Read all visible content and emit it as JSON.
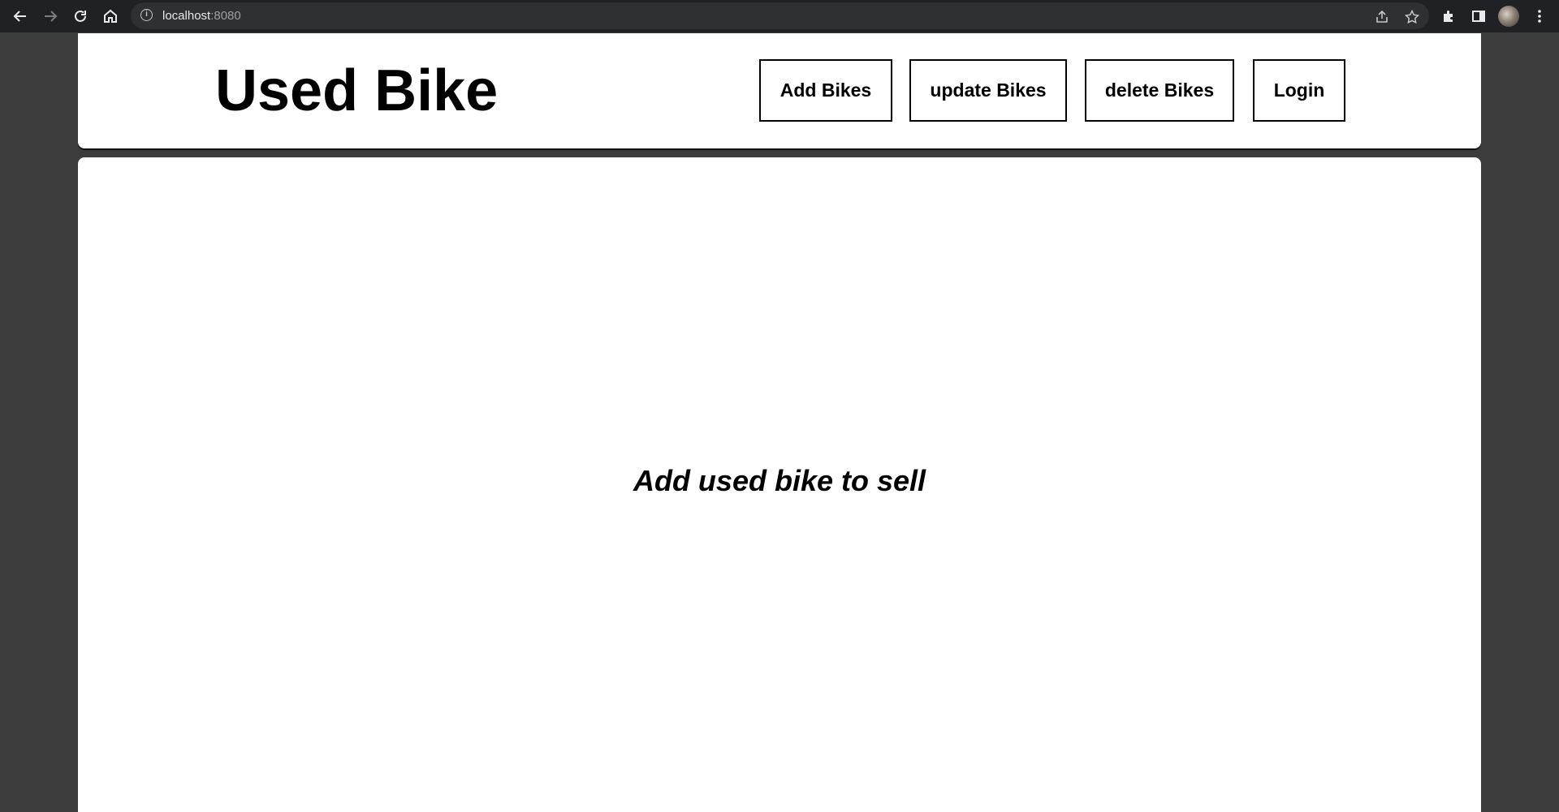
{
  "browser": {
    "url_host": "localhost",
    "url_port": ":8080",
    "icons": [
      "back-icon",
      "forward-icon",
      "reload-icon",
      "home-icon",
      "site-info-icon",
      "share-icon",
      "bookmark-star-icon",
      "extensions-icon",
      "side-panel-icon",
      "profile-avatar",
      "menu-kebab-icon"
    ]
  },
  "header": {
    "title": "Used Bike",
    "buttons": {
      "add": "Add Bikes",
      "update": "update Bikes",
      "delete": "delete Bikes",
      "login": "Login"
    }
  },
  "main": {
    "tagline": "Add used bike to sell"
  },
  "colors": {
    "page_background": "#3c3c3c",
    "card_background": "#ffffff",
    "text": "#000000"
  }
}
